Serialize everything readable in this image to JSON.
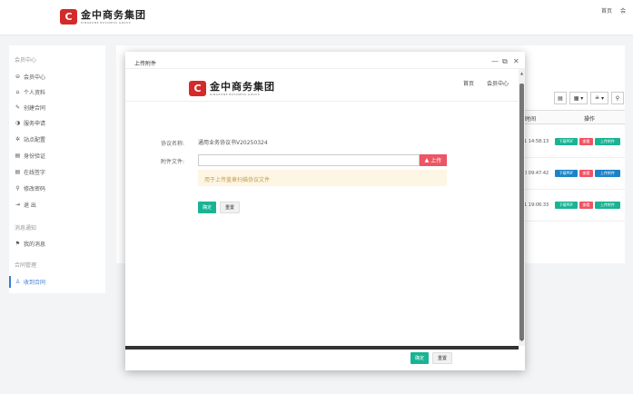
{
  "header": {
    "logo_mark": "C",
    "logo_cn": "金中商务集团",
    "logo_en": "KINGZONE BUSINESS GROUP",
    "nav": [
      "首页",
      "会"
    ]
  },
  "sidebar": {
    "section_member": "会员中心",
    "items_member": [
      {
        "icon": "⊖",
        "label": "会员中心"
      },
      {
        "icon": "⌂",
        "label": "个人资料"
      },
      {
        "icon": "✎",
        "label": "创建合同"
      },
      {
        "icon": "◑",
        "label": "服务申请"
      },
      {
        "icon": "✲",
        "label": "站点配置"
      },
      {
        "icon": "▤",
        "label": "身份验证"
      },
      {
        "icon": "▤",
        "label": "在线签字"
      },
      {
        "icon": "⚲",
        "label": "修改密码"
      },
      {
        "icon": "⇥",
        "label": "退 出"
      }
    ],
    "section_notice": "消息通知",
    "items_notice": [
      {
        "icon": "⚑",
        "label": "我的消息"
      }
    ],
    "section_contract": "合同管理",
    "items_contract": [
      {
        "icon": "♙",
        "label": "收到合同"
      }
    ]
  },
  "background_table": {
    "toolbar": [
      "▤",
      "▦ ▾",
      "≗ ▾",
      "⚲"
    ],
    "col_time_partial": "时间",
    "col_action": "操作",
    "rows": [
      {
        "time": "1 14:58:13",
        "actions": [
          "下载PDF",
          "查看",
          "上传附件"
        ]
      },
      {
        "time": "0 09:47:42",
        "actions": [
          "下载PDF",
          "查看",
          "上传附件"
        ]
      },
      {
        "time": "1 19:06:33",
        "actions": [
          "下载PDF",
          "查看",
          "上传附件"
        ]
      }
    ]
  },
  "modal": {
    "title": "上传附件",
    "ctrl_min": "—",
    "ctrl_max": "⧉",
    "ctrl_close": "✕",
    "inner": {
      "logo_mark": "C",
      "logo_cn": "金中商务集团",
      "logo_en": "KINGZONE BUSINESS GROUP",
      "nav_home": "首页",
      "nav_member": "会员中心",
      "label_name": "协议名称:",
      "value_name": "通用业务协议书V20250324",
      "label_file": "附件文件:",
      "file_placeholder": "",
      "upload_label": "上传",
      "hint": "用于上传盖章扫描协议文件",
      "btn_ok": "确定",
      "btn_reset": "重置"
    },
    "footer": {
      "btn_ok": "确定",
      "btn_reset": "重置"
    }
  },
  "colors": {
    "accent_green": "#1ab394",
    "danger_red": "#ed5565",
    "link_blue": "#3a7bd5",
    "brand_red": "#d42a2a"
  }
}
